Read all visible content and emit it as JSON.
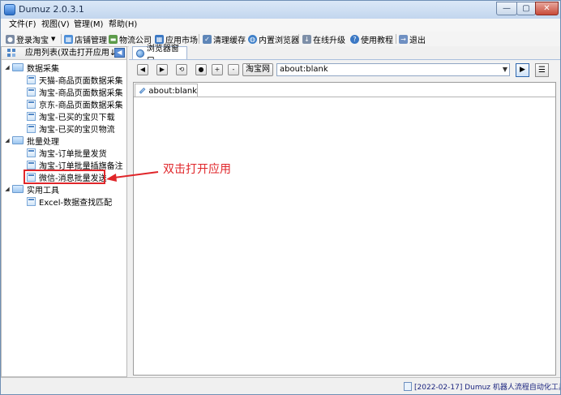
{
  "window": {
    "title": "Dumuz 2.0.3.1"
  },
  "menu": [
    "文件(F)",
    "视图(V)",
    "管理(M)",
    "帮助(H)"
  ],
  "toolbar": {
    "login": "登录淘宝",
    "shop": "店铺管理",
    "logistics": "物流公司",
    "market": "应用市场",
    "clear_cache": "清理缓存",
    "browser": "内置浏览器",
    "upgrade": "在线升级",
    "tutorial": "使用教程",
    "exit": "退出"
  },
  "left_panel": {
    "title": "应用列表(双击打开应用↓)",
    "pin_label": "◀",
    "groups": [
      {
        "label": "数据采集",
        "items": [
          "天猫-商品页面数据采集",
          "淘宝-商品页面数据采集",
          "京东-商品页面数据采集",
          "淘宝-已买的宝贝下载",
          "淘宝-已买的宝贝物流"
        ]
      },
      {
        "label": "批量处理",
        "items": [
          "淘宝-订单批量发货",
          "淘宝-订单批量插旗备注",
          "微信-消息批量发送"
        ]
      },
      {
        "label": "实用工具",
        "items": [
          "Excel-数据查找匹配"
        ]
      }
    ]
  },
  "browser": {
    "tab_label": "浏览器窗口",
    "taobao_button": "淘宝网",
    "url": "about:blank",
    "page_tab": "about:blank",
    "nav": {
      "back": "◀",
      "forward": "▶",
      "refresh": "⟲",
      "stop": "●",
      "zoom_in": "+",
      "zoom_out": "-",
      "go": "▶",
      "menu": "☰"
    }
  },
  "annotation": "双击打开应用",
  "status": "[2022-02-17] Dumuz 机器人流程自动化工具"
}
